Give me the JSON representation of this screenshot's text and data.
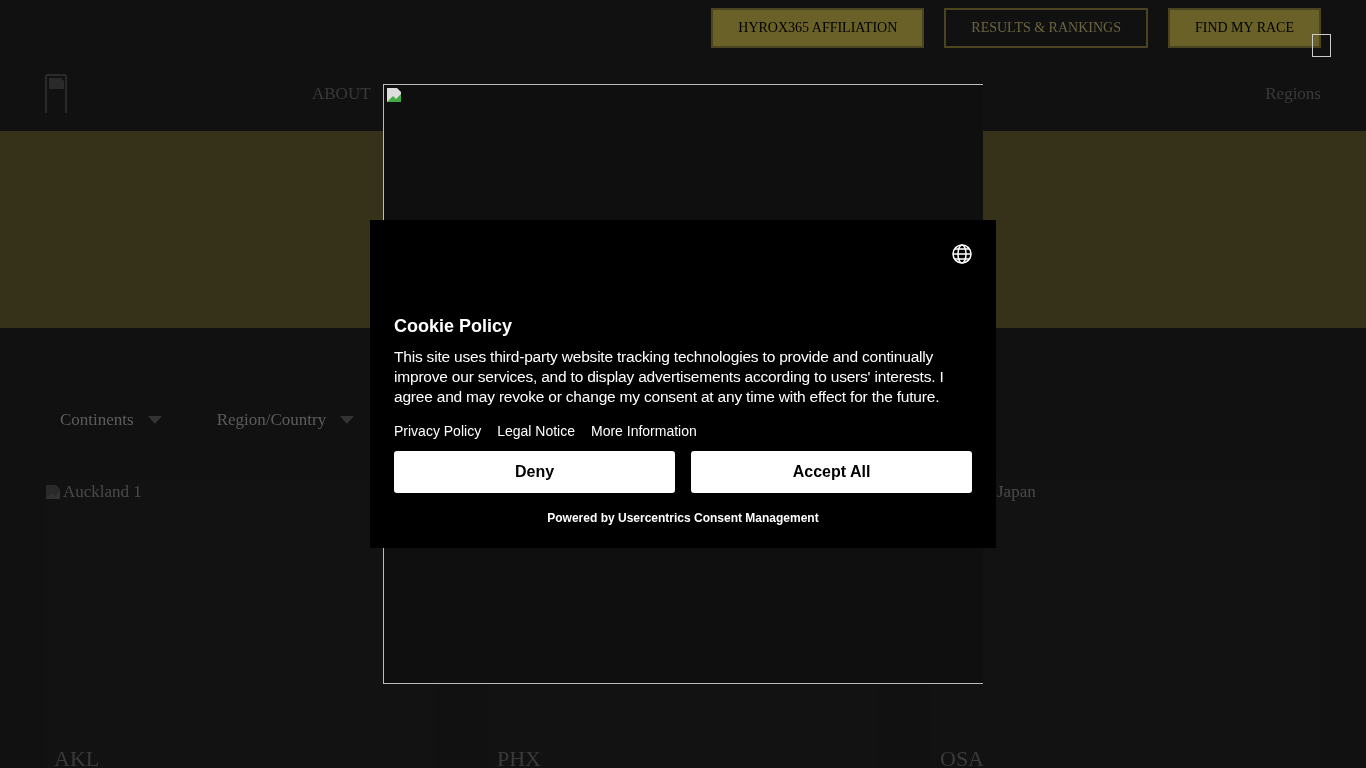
{
  "top_buttons": [
    {
      "label": "HYROX365 AFFILIATION",
      "kind": "filled"
    },
    {
      "label": "RESULTS & RANKINGS",
      "kind": "outline"
    },
    {
      "label": "FIND MY RACE",
      "kind": "filled"
    }
  ],
  "nav": {
    "links": [
      "ABOUT"
    ],
    "regions": "Regions"
  },
  "filters": [
    "Continents",
    "Region/Country"
  ],
  "cards": [
    {
      "image_alt": "Auckland 1",
      "code": "AKL"
    },
    {
      "code": "PHX"
    },
    {
      "image_alt": "Japan",
      "code": "OSA"
    }
  ],
  "cookie": {
    "title": "Cookie Policy",
    "body": "This site uses third-party website tracking technologies to provide and continually improve our services, and to display advertisements according to users' interests. I agree and may revoke or change my consent at any time with effect for the future.",
    "links": [
      "Privacy Policy",
      "Legal Notice",
      "More Information"
    ],
    "buttons": [
      "Deny",
      "Accept All"
    ],
    "powered_by": "Powered by Usercentrics Consent Management"
  }
}
